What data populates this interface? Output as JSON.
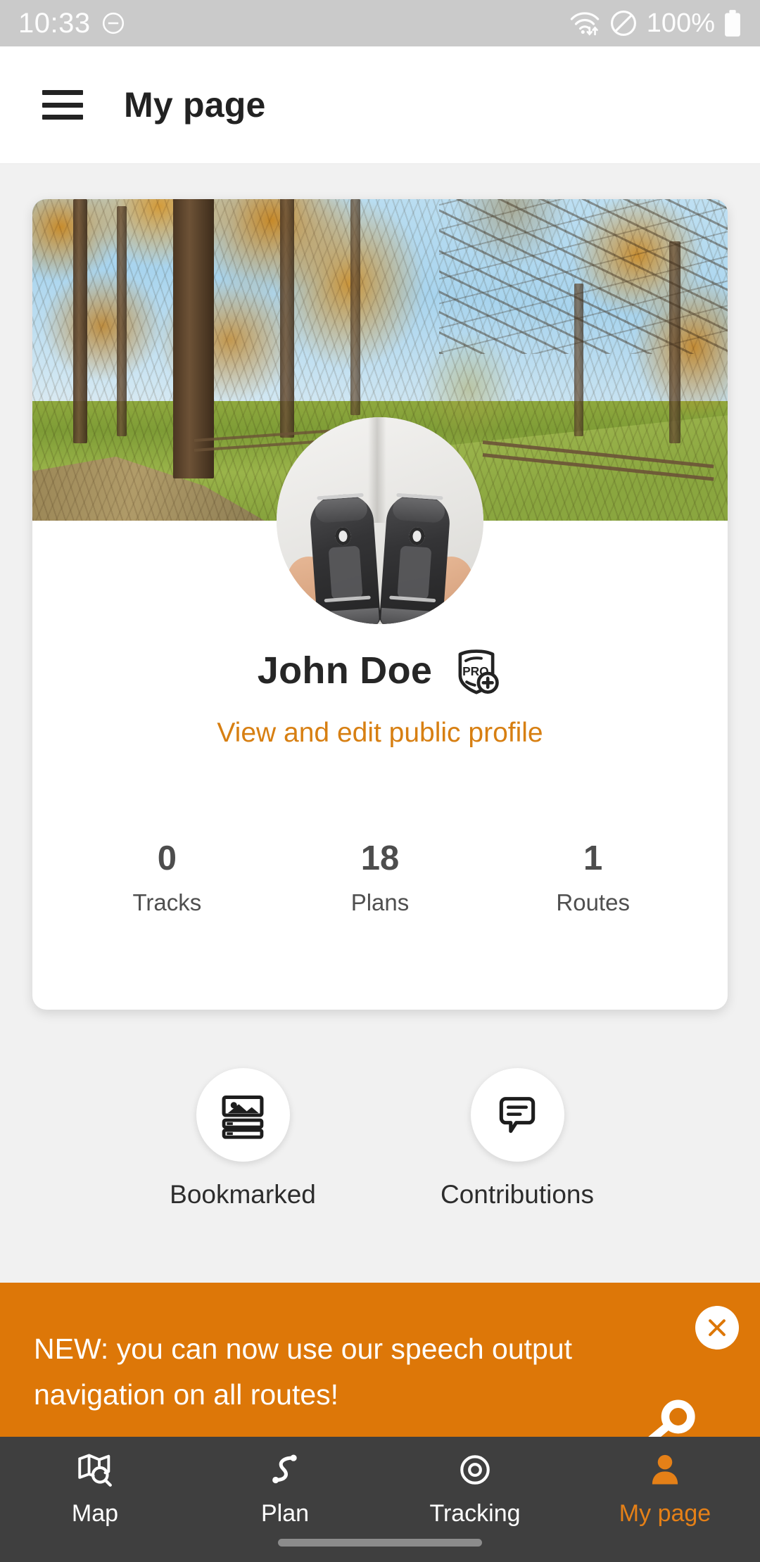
{
  "statusbar": {
    "time": "10:33",
    "dnd_icon": "do-not-disturb-icon",
    "wifi_icon": "wifi-transfer-icon",
    "blocked_icon": "no-symbol-icon",
    "battery_text": "100%",
    "battery_icon": "battery-full-icon"
  },
  "appbar": {
    "menu_icon": "hamburger-menu-icon",
    "title": "My page"
  },
  "profile": {
    "cover_alt": "autumn larch forest with blue sky, meadow and wooden fence",
    "avatar_alt": "hands holding a pair of black hiking boots against a white jacket",
    "name": "John Doe",
    "badge_icon": "pro-plus-shield-badge",
    "badge_text": "PRO",
    "edit_link": "View and edit public profile",
    "stats": [
      {
        "value": "0",
        "label": "Tracks"
      },
      {
        "value": "18",
        "label": "Plans"
      },
      {
        "value": "1",
        "label": "Routes"
      }
    ]
  },
  "shortcuts": [
    {
      "label": "Bookmarked",
      "icon": "bookmarked-list-icon"
    },
    {
      "label": "Contributions",
      "icon": "speech-bubble-icon"
    }
  ],
  "banner": {
    "text": "NEW: you can now use our speech output navigation on all routes!",
    "close_icon": "close-icon",
    "decor_icon": "megaphone-icon",
    "background": "#dd7708"
  },
  "bottomnav": {
    "items": [
      {
        "label": "Map",
        "icon": "map-search-icon",
        "active": false
      },
      {
        "label": "Plan",
        "icon": "route-line-icon",
        "active": false
      },
      {
        "label": "Tracking",
        "icon": "target-circle-icon",
        "active": false
      },
      {
        "label": "My page",
        "icon": "person-icon",
        "active": true
      }
    ],
    "active_color": "#e58017",
    "background": "#3f3f3f"
  }
}
